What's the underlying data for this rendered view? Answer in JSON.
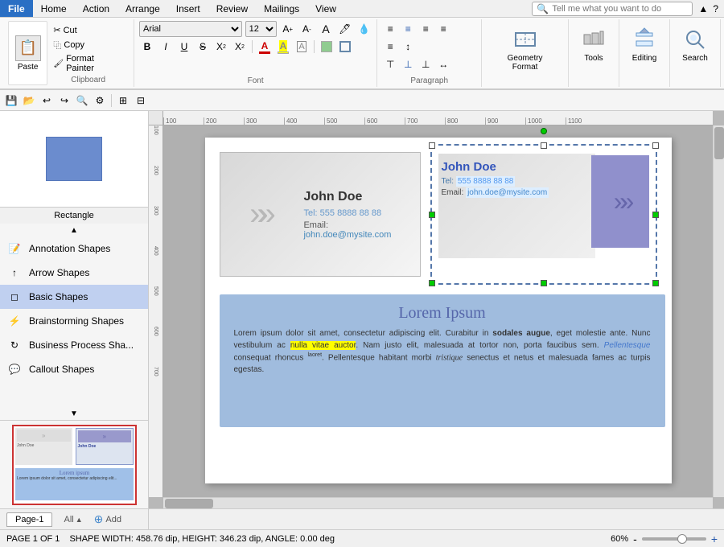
{
  "menu": {
    "file": "File",
    "home": "Home",
    "action": "Action",
    "arrange": "Arrange",
    "insert": "Insert",
    "review": "Review",
    "mailings": "Mailings",
    "view": "View",
    "search_placeholder": "Tell me what you want to do",
    "help": "?"
  },
  "ribbon": {
    "clipboard": {
      "paste": "Paste",
      "cut": "Cut",
      "copy": "Copy",
      "format_painter": "Format Painter",
      "label": "Clipboard"
    },
    "font": {
      "font_name": "Arial",
      "font_size": "12",
      "label": "Font"
    },
    "paragraph": {
      "label": "Paragraph"
    },
    "geometry": {
      "label": "Geometry Format"
    },
    "tools": {
      "label": "Tools"
    },
    "editing": {
      "label": "Editing"
    },
    "search": {
      "label": "Search"
    }
  },
  "shapes": {
    "preview_label": "Rectangle",
    "items": [
      {
        "name": "Annotation Shapes",
        "icon": "📝"
      },
      {
        "name": "Arrow Shapes",
        "icon": "↑"
      },
      {
        "name": "Basic Shapes",
        "icon": "◻"
      },
      {
        "name": "Brainstorming Shapes",
        "icon": "⚡"
      },
      {
        "name": "Business Process Sha...",
        "icon": "↻"
      },
      {
        "name": "Callout Shapes",
        "icon": "💬"
      }
    ]
  },
  "canvas": {
    "ruler_marks": [
      "100",
      "200",
      "300",
      "400",
      "500",
      "600",
      "700",
      "800",
      "900",
      "1000",
      "1100"
    ],
    "ruler_left_marks": [
      "100",
      "200",
      "300",
      "400",
      "500",
      "600",
      "700"
    ],
    "biz_card": {
      "name": "John Doe",
      "tel_label": "Tel:",
      "tel": "555 8888 88 88",
      "email_label": "Email:",
      "email": "john.doe@mysite.com"
    },
    "sel_card": {
      "name": "John Doe",
      "tel": "555 8888 88 88",
      "email": "john.doe@mysite.com"
    },
    "lorem": {
      "title": "Lorem Ipsum",
      "text1": "Lorem ipsum dolor sit amet, consectetur adipiscing elit. Curabitur in ",
      "bold1": "sodales augue",
      "text2": ", eget molestie ante. Nunc vestibulum ac ",
      "highlight": "nulla vitae auctor",
      "text3": ". Nam justo elit, malesuada at tortor non, porta faucibus sem. ",
      "italic1": "Pellentesque",
      "text4": " consequat rhoncus ",
      "sup": "laoret",
      "text5": ". Pellentesque habitant morbi ",
      "cursive1": "tristique",
      "text6": " senectus et netus et malesuada fames ac turpis egestas."
    }
  },
  "pages": {
    "tab1": "Page-1",
    "all": "All",
    "add": "Add"
  },
  "status": {
    "page_info": "PAGE 1 OF 1",
    "shape_info": "SHAPE WIDTH: 458.76 dip, HEIGHT: 346.23 dip, ANGLE: 0.00 deg",
    "zoom": "60%"
  }
}
